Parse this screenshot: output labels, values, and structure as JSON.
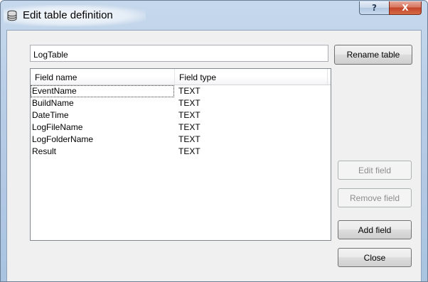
{
  "window": {
    "title": "Edit table definition",
    "help_glyph": "?",
    "close_glyph": "X"
  },
  "table_name": {
    "value": "LogTable"
  },
  "buttons": {
    "rename": "Rename table",
    "edit_field": "Edit field",
    "remove_field": "Remove field",
    "add_field": "Add field",
    "close": "Close"
  },
  "fields_list": {
    "columns": [
      "Field name",
      "Field type"
    ],
    "rows": [
      {
        "name": "EventName",
        "type": "TEXT"
      },
      {
        "name": "BuildName",
        "type": "TEXT"
      },
      {
        "name": "DateTime",
        "type": "TEXT"
      },
      {
        "name": "LogFileName",
        "type": "TEXT"
      },
      {
        "name": "LogFolderName",
        "type": "TEXT"
      },
      {
        "name": "Result",
        "type": "TEXT"
      }
    ]
  },
  "icons": {
    "title_icon": "database-icon"
  }
}
